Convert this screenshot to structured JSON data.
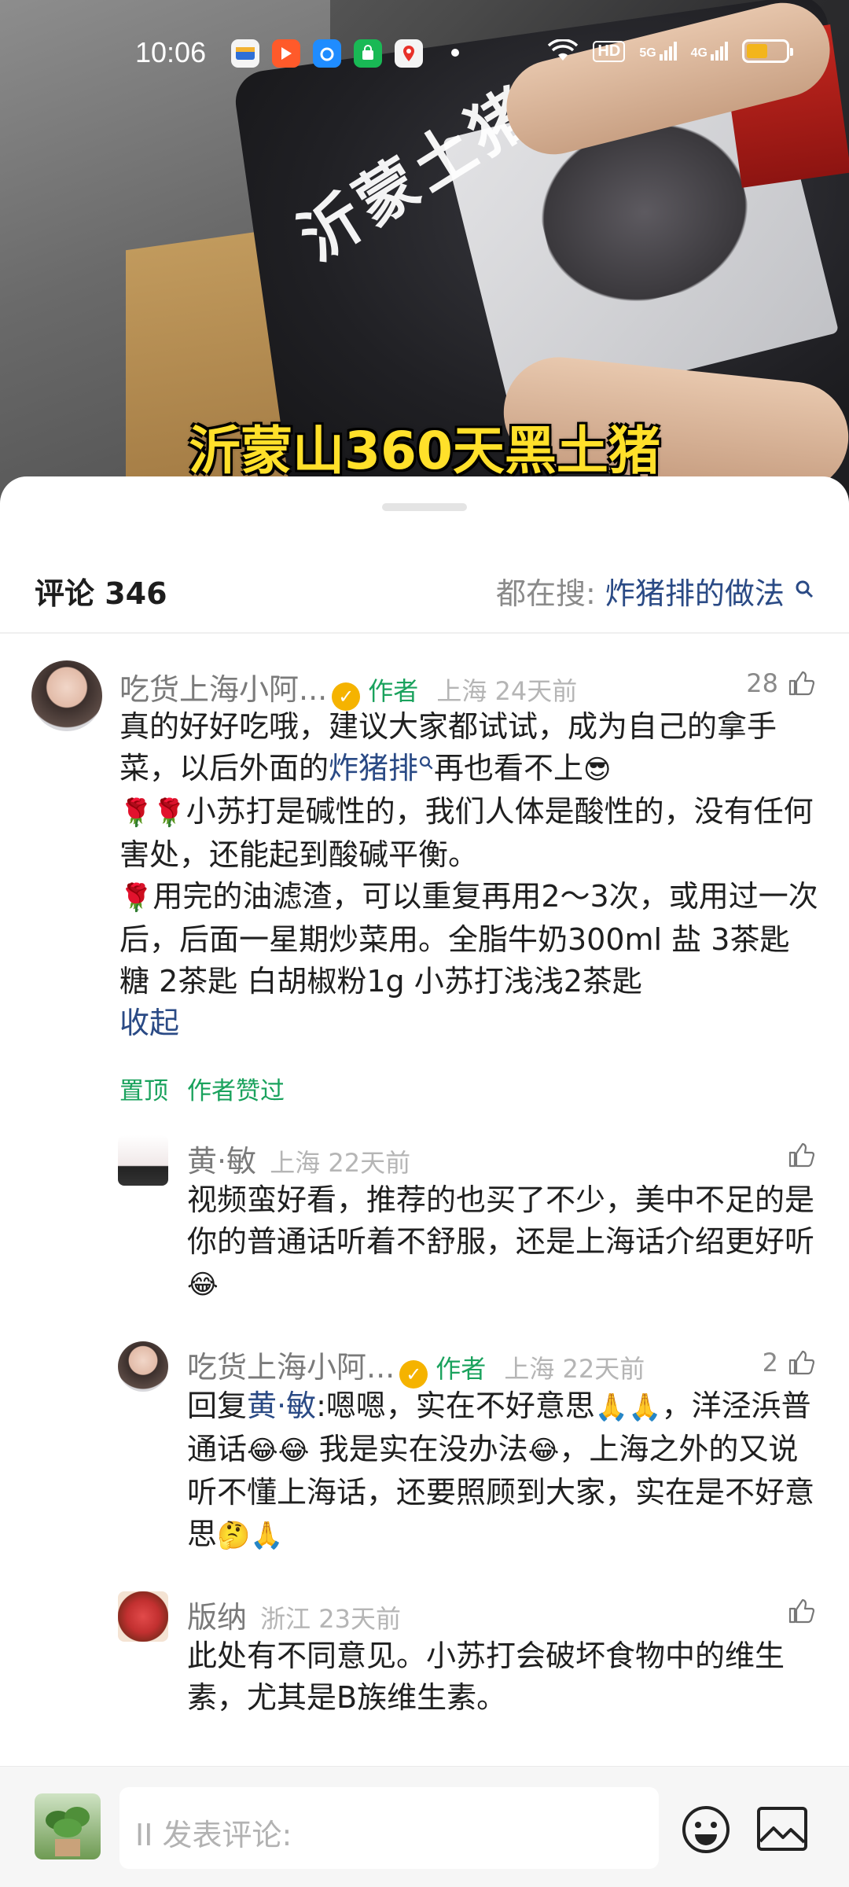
{
  "status_bar": {
    "time": "10:06",
    "network": [
      "HD",
      "5G",
      "4G"
    ],
    "battery_level": 0.55
  },
  "video": {
    "brand_text": "沂蒙土猪",
    "subtitle": "沂蒙山360天黑土猪"
  },
  "header": {
    "comment_count": "评论 346",
    "search_prefix": "都在搜: ",
    "search_keyword": "炸猪排的做法"
  },
  "comments": [
    {
      "name": "吃货上海小阿...",
      "tag": "作者",
      "meta": "上海  24天前",
      "likes": "28",
      "body_p1": "真的好好吃哦，建议大家都试试，成为自己的拿手菜，以后外面的",
      "body_link": "炸猪排",
      "body_p2": "再也看不上",
      "body_p3": "小苏打是碱性的，我们人体是酸性的，没有任何害处，还能起到酸碱平衡。",
      "body_p4": "用完的油滤渣，可以重复再用2～3次，或用过一次后，后面一星期炒菜用。全脂牛奶300ml 盐 3茶匙 糖 2茶匙 白胡椒粉1g 小苏打浅浅2茶匙",
      "collapse": "收起",
      "tag_pinned": "置顶",
      "tag_liked": "作者赞过"
    },
    {
      "name": "黄·敏",
      "meta": "上海  22天前",
      "likes": "",
      "body": "视频蛮好看，推荐的也买了不少，美中不足的是你的普通话听着不舒服，还是上海话介绍更好听"
    },
    {
      "name": "吃货上海小阿...",
      "tag": "作者",
      "meta": "上海  22天前",
      "likes": "2",
      "reply_prefix": "回复",
      "reply_to": "黄·敏",
      "body_a": ":嗯嗯，实在不好意思",
      "body_b": "，洋泾浜普通话",
      "body_c": " 我是实在没办法",
      "body_d": "，上海之外的又说听不懂上海话，还要照顾到大家，实在是不好意思"
    },
    {
      "name": "版纳",
      "meta": "浙江  23天前",
      "likes": "",
      "body": "此处有不同意见。小苏打会破坏食物中的维生素，尤其是B族维生素。"
    }
  ],
  "composer": {
    "placeholder": "II 发表评论:"
  }
}
